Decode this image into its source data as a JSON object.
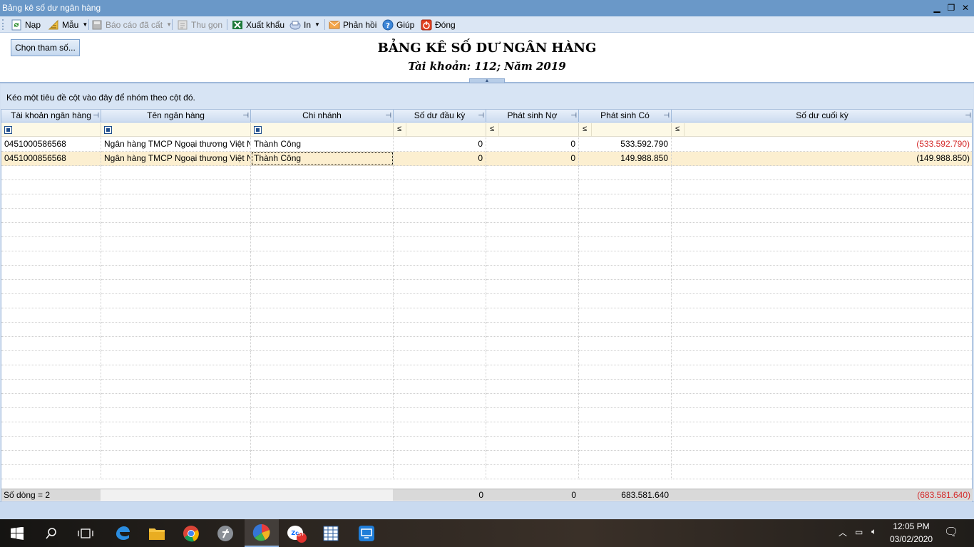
{
  "window": {
    "title": "Bảng kê số dư ngân hàng"
  },
  "toolbar": {
    "reload": "Nạp",
    "template": "Mẫu",
    "saved_reports": "Báo cáo đã cất",
    "collapse": "Thu gọn",
    "export": "Xuất khẩu",
    "print": "In",
    "feedback": "Phản hồi",
    "help": "Giúp",
    "close": "Đóng"
  },
  "header": {
    "param_button": "Chọn tham số...",
    "title": "BẢNG KÊ SỐ DƯ NGÂN HÀNG",
    "subtitle": "Tài khoản: 112; Năm 2019"
  },
  "grid": {
    "group_hint": "Kéo một tiêu đề cột vào đây để nhóm theo cột đó.",
    "columns": [
      "Tài khoản ngân hàng",
      "Tên ngân hàng",
      "Chi nhánh",
      "Số dư đầu kỳ",
      "Phát sinh Nợ",
      "Phát sinh Có",
      "Số dư cuối kỳ"
    ],
    "filter_op": "≤",
    "rows": [
      {
        "account": "0451000586568",
        "bank": "Ngân hàng TMCP Ngoại thương Việt Na",
        "branch": "Thành Công",
        "opening": "0",
        "debit": "0",
        "credit": "533.592.790",
        "closing": "(533.592.790)"
      },
      {
        "account": "0451000856568",
        "bank": "Ngân hàng TMCP Ngoại thương Việt Na",
        "branch": "Thành  Công",
        "opening": "0",
        "debit": "0",
        "credit": "149.988.850",
        "closing": "(149.988.850)"
      }
    ],
    "footer": {
      "count": "Số dòng = 2",
      "opening": "0",
      "debit": "0",
      "credit": "683.581.640",
      "closing": "(683.581.640)"
    }
  },
  "taskbar": {
    "time": "12:05 PM",
    "date": "03/02/2020",
    "zalo_badge": "5+"
  },
  "colors": {
    "title_bar": "#6a98c8",
    "toolbar": "#dbe6f4",
    "negative": "#d42b2b",
    "selected_row": "#fcefd0",
    "filter_row": "#fdf9e6"
  }
}
